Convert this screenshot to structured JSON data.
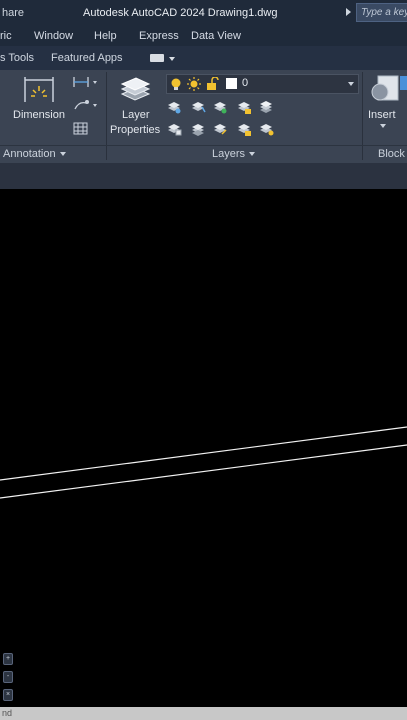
{
  "titlebar": {
    "share_label": "hare",
    "app_title": "Autodesk AutoCAD 2024    Drawing1.dwg",
    "search_placeholder": "Type a key"
  },
  "menubar": {
    "items": [
      "ric",
      "Window",
      "Help",
      "Express",
      "Data View"
    ]
  },
  "ribbon_tabs": {
    "items": [
      "s Tools",
      "Featured Apps"
    ]
  },
  "ribbon": {
    "annotation": {
      "dimension_label": "Dimension",
      "panel_label": "Annotation"
    },
    "layers": {
      "layer_properties_label_1": "Layer",
      "layer_properties_label_2": "Properties",
      "current_layer": "0",
      "panel_label": "Layers"
    },
    "block": {
      "insert_label": "Insert",
      "panel_label": "Block"
    }
  },
  "colors": {
    "accent_yellow": "#f2c230",
    "ribbon_bg": "#3b4453",
    "titlebar_bg": "#1f2a3a",
    "canvas_bg": "#000000"
  },
  "canvas": {
    "viewcube_buttons": [
      "+",
      "-",
      "×"
    ]
  },
  "commandline": {
    "text": "nd"
  }
}
